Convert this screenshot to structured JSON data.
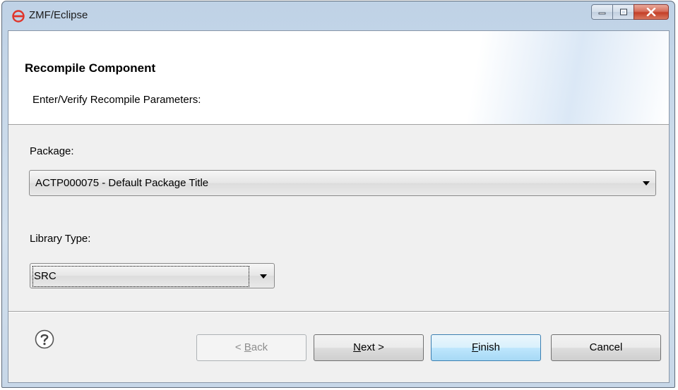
{
  "window": {
    "title": "ZMF/Eclipse",
    "controls": [
      "minimize",
      "maximize",
      "close"
    ]
  },
  "header": {
    "title": "Recompile Component",
    "subtitle": "Enter/Verify Recompile Parameters:"
  },
  "form": {
    "package": {
      "label": "Package:",
      "value": "ACTP000075 - Default Package Title"
    },
    "library_type": {
      "label": "Library Type:",
      "value": "SRC"
    }
  },
  "buttons": {
    "back": {
      "prefix": "< ",
      "mnemonic": "B",
      "rest": "ack"
    },
    "next": {
      "mnemonic": "N",
      "rest": "ext >"
    },
    "finish": {
      "mnemonic": "F",
      "rest": "inish"
    },
    "cancel": {
      "label": "Cancel"
    }
  },
  "colors": {
    "app_icon": "#e0352b",
    "close_button": "#c43f27",
    "default_button": "#3c7fb1"
  },
  "icons": [
    "app-logo-icon",
    "minimize-icon",
    "maximize-icon",
    "close-icon",
    "help-icon",
    "dropdown-arrow-icon"
  ]
}
